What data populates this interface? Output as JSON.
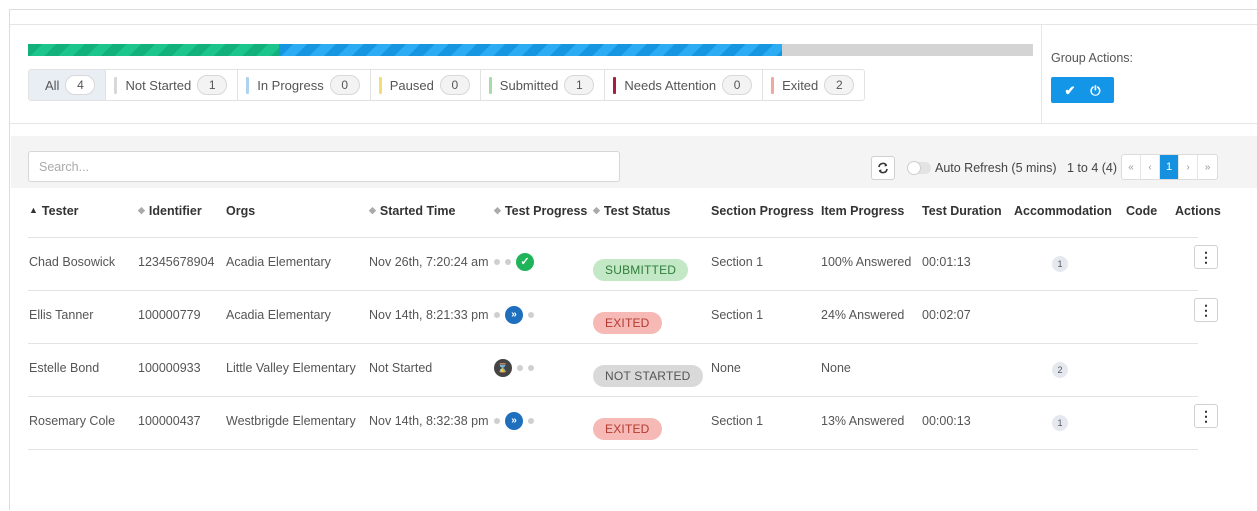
{
  "progress": {
    "submitted_fraction": 0.25,
    "in_progress_fraction": 0.5,
    "remaining_fraction": 0.25,
    "colors": {
      "submitted": "#12b07a",
      "in_progress": "#1696e0",
      "remaining": "#d4d4d4"
    }
  },
  "filters": [
    {
      "label": "All",
      "count": "4",
      "marker_color": "",
      "active": true
    },
    {
      "label": "Not Started",
      "count": "1",
      "marker_color": "#d8d8d8"
    },
    {
      "label": "In Progress",
      "count": "0",
      "marker_color": "#aed3f0"
    },
    {
      "label": "Paused",
      "count": "0",
      "marker_color": "#f4dd79"
    },
    {
      "label": "Submitted",
      "count": "1",
      "marker_color": "#a8dba8"
    },
    {
      "label": "Needs Attention",
      "count": "0",
      "marker_color": "#a3213a"
    },
    {
      "label": "Exited",
      "count": "2",
      "marker_color": "#f2a8a0"
    }
  ],
  "group_actions": {
    "title": "Group Actions:",
    "accent": "#1396e8",
    "buttons": [
      {
        "icon": "double-check-icon",
        "glyph": "✔"
      },
      {
        "icon": "power-icon",
        "glyph": "⏻"
      }
    ]
  },
  "toolbar": {
    "search_placeholder": "Search...",
    "auto_refresh_label": "Auto Refresh (5 mins)",
    "range_label": "1 to 4 (4)",
    "pager": {
      "first": "«",
      "prev": "‹",
      "current": "1",
      "next": "›",
      "last": "»"
    }
  },
  "columns": {
    "tester": "Tester",
    "identifier": "Identifier",
    "orgs": "Orgs",
    "started_time": "Started Time",
    "test_progress": "Test Progress",
    "test_status": "Test Status",
    "section_progress": "Section Progress",
    "item_progress": "Item Progress",
    "test_duration": "Test Duration",
    "accommodation": "Accommodation",
    "code": "Code",
    "actions": "Actions"
  },
  "rows": [
    {
      "tester": "Chad Bosowick",
      "identifier": "12345678904",
      "orgs": "Acadia Elementary",
      "started": "Nov 26th, 7:20:24 am",
      "progress_icon": "check-icon",
      "status": "SUBMITTED",
      "section": "Section 1",
      "item": "100% Answered",
      "duration": "00:01:13",
      "accommodation": "1",
      "code": ""
    },
    {
      "tester": "Ellis Tanner",
      "identifier": "100000779",
      "orgs": "Acadia Elementary",
      "started": "Nov 14th, 8:21:33 pm",
      "progress_icon": "fast-forward-icon",
      "status": "EXITED",
      "section": "Section 1",
      "item": "24% Answered",
      "duration": "00:02:07",
      "accommodation": "",
      "code": ""
    },
    {
      "tester": "Estelle Bond",
      "identifier": "100000933",
      "orgs": "Little Valley Elementary",
      "started": "Not Started",
      "progress_icon": "hourglass-icon",
      "status": "NOT STARTED",
      "section": "None",
      "item": "None",
      "duration": "",
      "accommodation": "2",
      "code": ""
    },
    {
      "tester": "Rosemary Cole",
      "identifier": "100000437",
      "orgs": "Westbrigde Elementary",
      "started": "Nov 14th, 8:32:38 pm",
      "progress_icon": "fast-forward-icon",
      "status": "EXITED",
      "section": "Section 1",
      "item": "13% Answered",
      "duration": "00:00:13",
      "accommodation": "1",
      "code": ""
    }
  ],
  "actions_icon": "kebab-menu-icon"
}
